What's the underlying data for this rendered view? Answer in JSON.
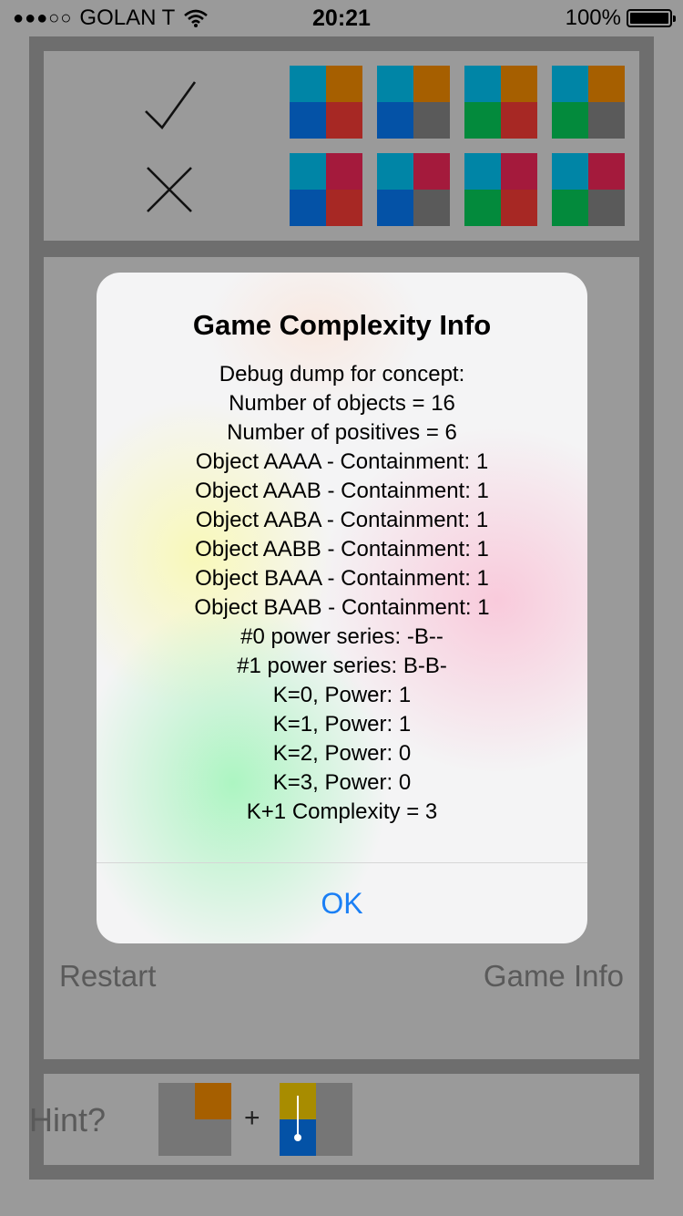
{
  "status_bar": {
    "signal_dots": "●●●○○",
    "carrier": "GOLAN T",
    "time": "20:21",
    "battery_percent": "100%"
  },
  "colors": {
    "teal": "#0085a6",
    "orange": "#a65f00",
    "blue": "#0452a6",
    "red": "#a72824",
    "gray": "#5a5a5a",
    "green": "#038a3c",
    "crimson": "#a41a3c",
    "yellow": "#a88c00",
    "panel_gray": "#767676"
  },
  "positive_examples": [
    [
      "teal",
      "orange",
      "blue",
      "red"
    ],
    [
      "teal",
      "orange",
      "blue",
      "gray"
    ],
    [
      "teal",
      "orange",
      "green",
      "red"
    ],
    [
      "teal",
      "orange",
      "green",
      "gray"
    ]
  ],
  "negative_examples": [
    [
      "teal",
      "crimson",
      "blue",
      "red"
    ],
    [
      "teal",
      "crimson",
      "blue",
      "gray"
    ],
    [
      "teal",
      "crimson",
      "green",
      "red"
    ],
    [
      "teal",
      "crimson",
      "green",
      "gray"
    ]
  ],
  "buttons": {
    "restart": "Restart",
    "game_info": "Game Info"
  },
  "hint": {
    "label": "Hint?",
    "plus": "+"
  },
  "alert": {
    "title": "Game Complexity Info",
    "lines": [
      "Debug dump for concept:",
      "Number of objects = 16",
      "Number of positives = 6",
      "Object AAAA - Containment: 1",
      "Object AAAB - Containment: 1",
      "Object AABA - Containment: 1",
      "Object AABB - Containment: 1",
      "Object BAAA - Containment: 1",
      "Object BAAB - Containment: 1",
      "#0 power series: -B--",
      "#1 power series: B-B-",
      "K=0, Power: 1",
      "K=1, Power: 1",
      "K=2, Power: 0",
      "K=3, Power: 0",
      "K+1 Complexity = 3"
    ],
    "ok": "OK"
  }
}
